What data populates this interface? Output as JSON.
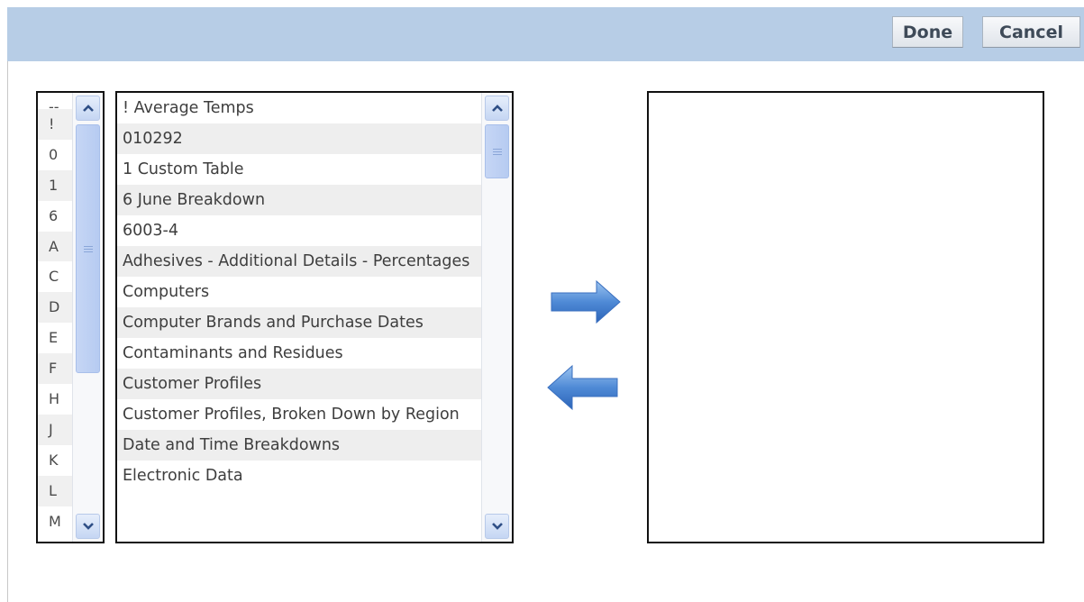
{
  "toolbar": {
    "done_label": "Done",
    "cancel_label": "Cancel"
  },
  "letter_filter": {
    "items": [
      "--",
      "!",
      "0",
      "1",
      "6",
      "A",
      "C",
      "D",
      "E",
      "F",
      "H",
      "J",
      "K",
      "L",
      "M"
    ]
  },
  "available_tables": {
    "items": [
      "! Average Temps",
      "010292",
      "1 Custom Table",
      "6 June Breakdown",
      "6003-4",
      "Adhesives - Additional Details - Percentages",
      "Computers",
      "Computer Brands and Purchase Dates",
      "Contaminants and Residues",
      "Customer Profiles",
      "Customer Profiles, Broken Down by Region",
      "Date and Time Breakdowns",
      "Electronic Data"
    ]
  },
  "icons": {
    "add": "arrow-right-icon",
    "remove": "arrow-left-icon",
    "scroll_up": "chevron-up-icon",
    "scroll_down": "chevron-down-icon"
  },
  "colors": {
    "toolbar_bg": "#b7cde6",
    "arrow_blue": "#4f8ad6",
    "scroll_thumb": "#c6d6f5"
  }
}
